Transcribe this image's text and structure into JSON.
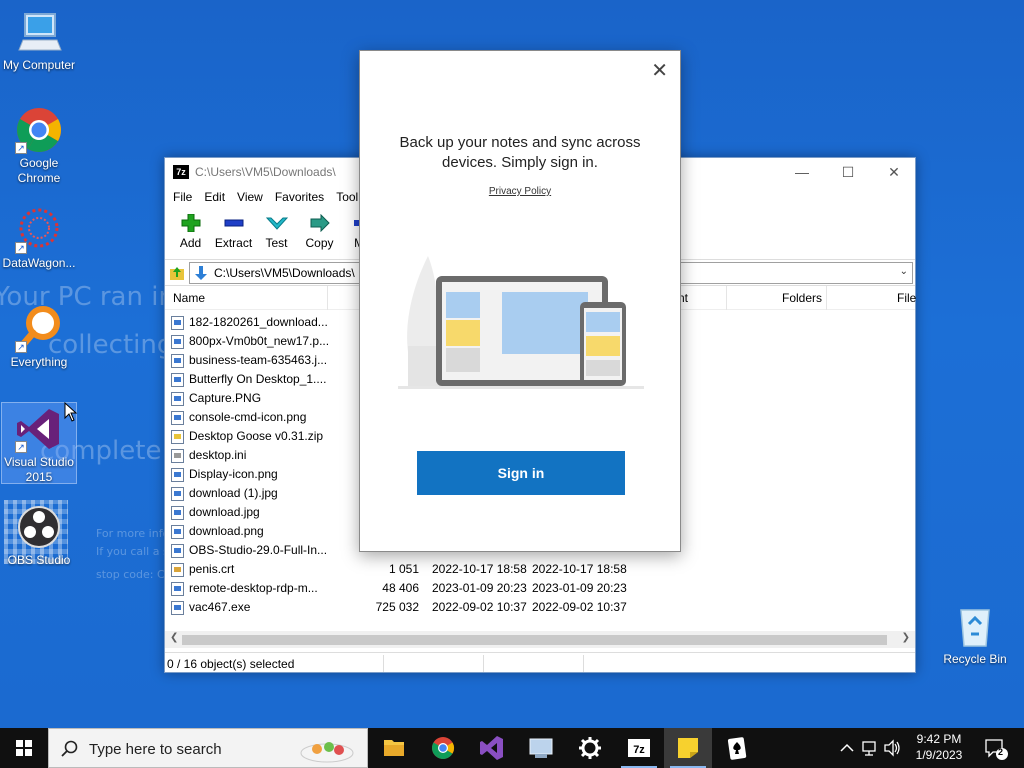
{
  "desktop": {
    "wallpaper_text": [
      "Your PC ran into",
      "collecting s",
      "complete",
      "For more infor",
      "If you call a s",
      "stop code: CRI"
    ],
    "icons": [
      {
        "label": "My Computer"
      },
      {
        "label": "Google Chrome"
      },
      {
        "label": "DataWagon..."
      },
      {
        "label": "Everything"
      },
      {
        "label": "Visual Studio 2015"
      },
      {
        "label": "OBS Studio"
      },
      {
        "label": "Recycle Bin"
      }
    ]
  },
  "sevenzip": {
    "title": "C:\\Users\\VM5\\Downloads\\",
    "app_icon": "7z",
    "menu": [
      "File",
      "Edit",
      "View",
      "Favorites",
      "Tool"
    ],
    "toolbar": [
      "Add",
      "Extract",
      "Test",
      "Copy",
      "Mo"
    ],
    "address": "C:\\Users\\VM5\\Downloads\\",
    "columns": {
      "name": "Name",
      "comment": "nt",
      "folders": "Folders",
      "files": "File"
    },
    "files": [
      {
        "name": "182-1820261_download...",
        "size": "",
        "modified": "",
        "created": "",
        "type": "img"
      },
      {
        "name": "800px-Vm0b0t_new17.p...",
        "size": "",
        "modified": "",
        "created": "",
        "type": "img"
      },
      {
        "name": "business-team-635463.j...",
        "size": "",
        "modified": "",
        "created": "",
        "type": "img"
      },
      {
        "name": "Butterfly On Desktop_1....",
        "size": "",
        "modified": "",
        "created": "",
        "type": "img"
      },
      {
        "name": "Capture.PNG",
        "size": "",
        "modified": "",
        "created": "",
        "type": "img"
      },
      {
        "name": "console-cmd-icon.png",
        "size": "",
        "modified": "",
        "created": "",
        "type": "img"
      },
      {
        "name": "Desktop Goose v0.31.zip",
        "size": "",
        "modified": "",
        "created": "",
        "type": "zip"
      },
      {
        "name": "desktop.ini",
        "size": "",
        "modified": "",
        "created": "",
        "type": "ini"
      },
      {
        "name": "Display-icon.png",
        "size": "",
        "modified": "",
        "created": "",
        "type": "img"
      },
      {
        "name": "download (1).jpg",
        "size": "",
        "modified": "",
        "created": "",
        "type": "img"
      },
      {
        "name": "download.jpg",
        "size": "",
        "modified": "",
        "created": "",
        "type": "img"
      },
      {
        "name": "download.png",
        "size": "",
        "modified": "",
        "created": "",
        "type": "img"
      },
      {
        "name": "OBS-Studio-29.0-Full-In...",
        "size": "",
        "modified": "",
        "created": "",
        "type": "img"
      },
      {
        "name": "penis.crt",
        "size": "1 051",
        "modified": "2022-10-17 18:58",
        "created": "2022-10-17 18:58",
        "type": "crt"
      },
      {
        "name": "remote-desktop-rdp-m...",
        "size": "48 406",
        "modified": "2023-01-09 20:23",
        "created": "2023-01-09 20:23",
        "type": "img"
      },
      {
        "name": "vac467.exe",
        "size": "725 032",
        "modified": "2022-09-02 10:37",
        "created": "2022-09-02 10:37",
        "type": "img"
      }
    ],
    "status": "0 / 16 object(s) selected"
  },
  "popup": {
    "heading": "Back up your notes and sync across devices. Simply sign in.",
    "privacy_link": "Privacy Policy",
    "signin_label": "Sign in"
  },
  "taskbar": {
    "search_placeholder": "Type here to search",
    "apps": [
      "file-explorer",
      "chrome",
      "visual-studio",
      "network-app",
      "settings",
      "7zip",
      "sticky-notes",
      "solitaire"
    ],
    "active_app": "sticky-notes",
    "clock_time": "9:42 PM",
    "clock_date": "1/9/2023",
    "notification_count": "2"
  },
  "colors": {
    "desktop_bg": "#1c6fd6",
    "signin_button": "#1273c2",
    "taskbar_bg": "#101010"
  }
}
